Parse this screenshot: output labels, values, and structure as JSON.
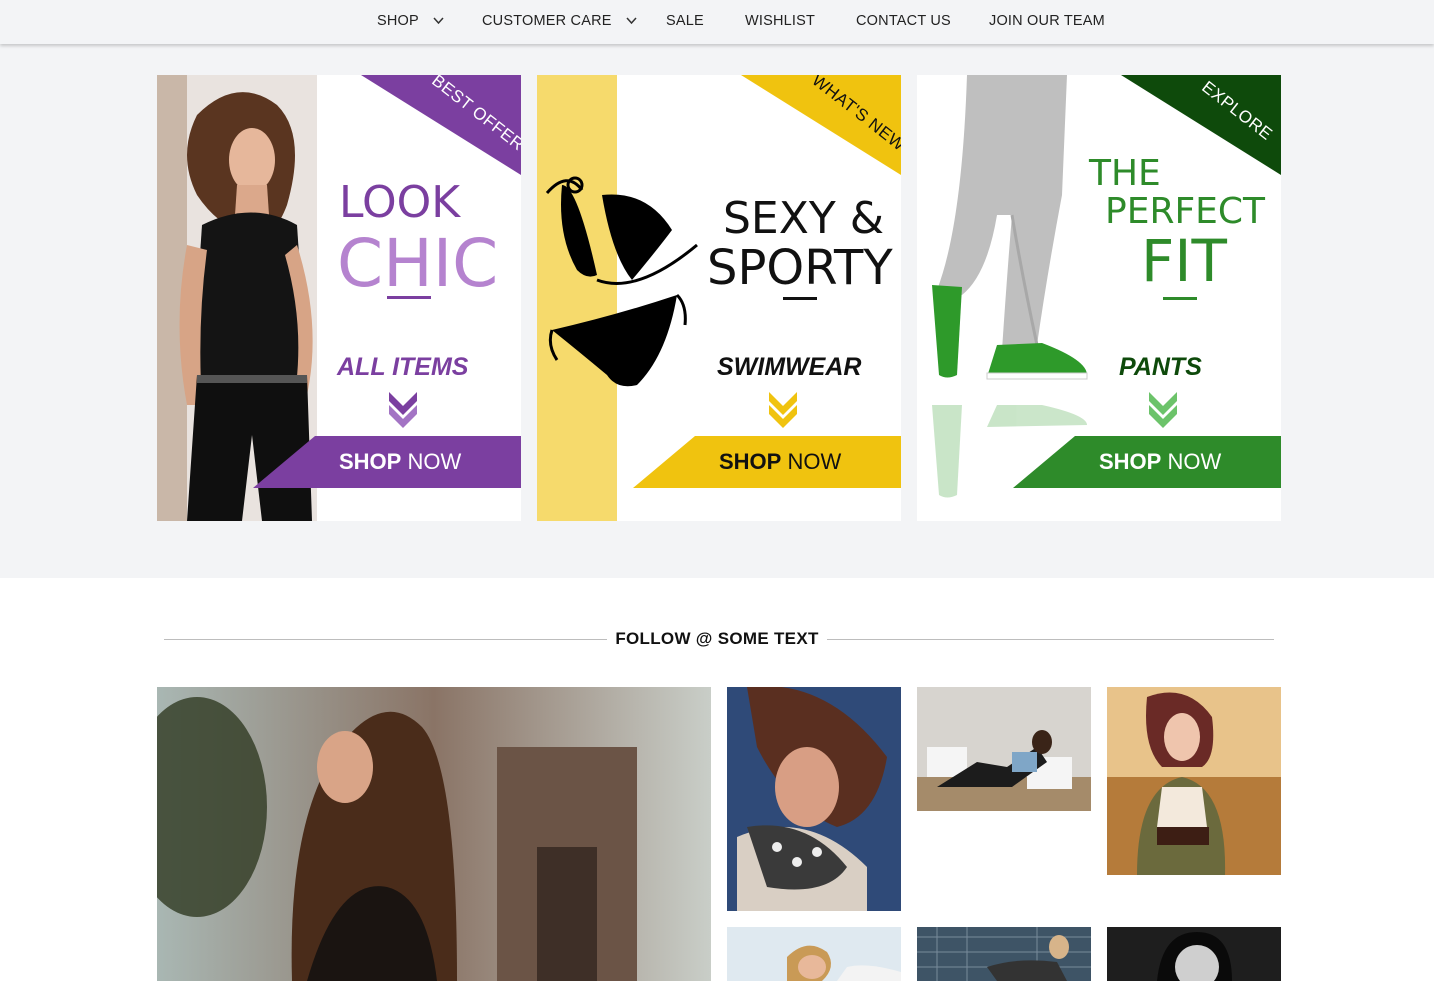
{
  "nav": {
    "items": [
      {
        "label": "SHOP",
        "has_dropdown": true
      },
      {
        "label": "CUSTOMER CARE",
        "has_dropdown": true
      },
      {
        "label": "SALE",
        "has_dropdown": false
      },
      {
        "label": "WISHLIST",
        "has_dropdown": false
      },
      {
        "label": "CONTACT US",
        "has_dropdown": false
      },
      {
        "label": "JOIN OUR TEAM",
        "has_dropdown": false
      }
    ]
  },
  "banners": [
    {
      "ribbon": "BEST OFFER",
      "headline_1": "LOOK",
      "headline_2": "CHIC",
      "subtitle": "ALL ITEMS",
      "shop_bold": "SHOP",
      "shop_rest": "NOW",
      "accent": "#7b3fa0",
      "accent_light": "#b583cf"
    },
    {
      "ribbon": "WHAT'S NEW",
      "headline_1": "SEXY &",
      "headline_2": "SPORTY",
      "subtitle": "SWIMWEAR",
      "shop_bold": "SHOP",
      "shop_rest": "NOW",
      "accent": "#f0c30f",
      "accent_light": "#f6da6c"
    },
    {
      "ribbon": "EXPLORE",
      "headline_1": "THE",
      "headline_2": "PERFECT",
      "headline_3": "FIT",
      "subtitle": "PANTS",
      "shop_bold": "SHOP",
      "shop_rest": "NOW",
      "accent": "#2e8b2a",
      "accent_dark": "#0e4a0b"
    }
  ],
  "follow": {
    "title": "FOLLOW @ SOME TEXT"
  },
  "gallery": {
    "photos": [
      {
        "name": "gallery-photo-large"
      },
      {
        "name": "gallery-photo-scarf"
      },
      {
        "name": "gallery-photo-floor"
      },
      {
        "name": "gallery-photo-field"
      },
      {
        "name": "gallery-photo-beach"
      },
      {
        "name": "gallery-photo-fence"
      },
      {
        "name": "gallery-photo-bw"
      }
    ]
  }
}
